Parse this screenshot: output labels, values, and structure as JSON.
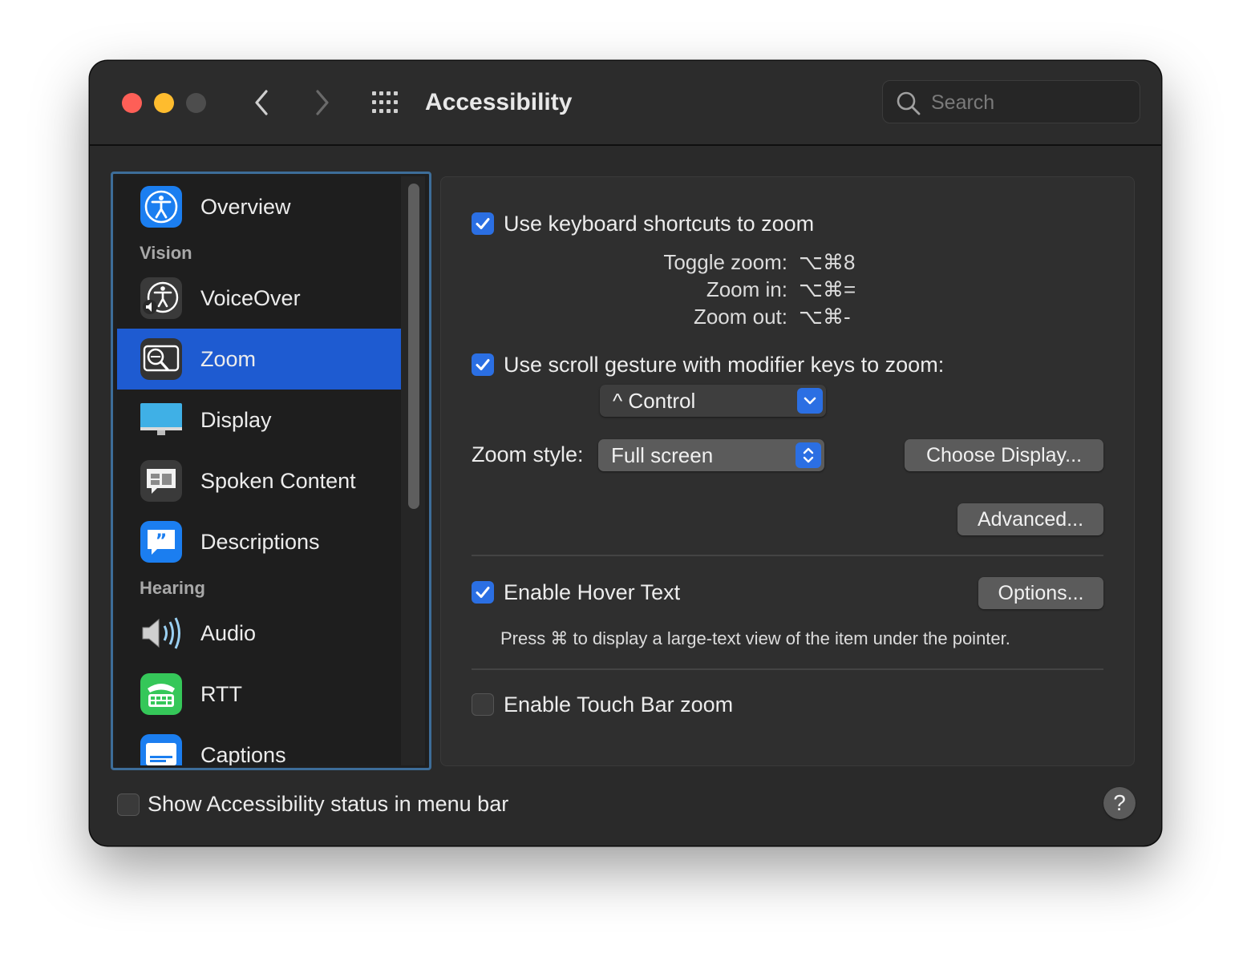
{
  "window": {
    "title": "Accessibility",
    "search_placeholder": "Search"
  },
  "sidebar": {
    "items": [
      {
        "id": "overview",
        "label": "Overview",
        "icon": "accessibility-icon"
      },
      {
        "id": "voiceover",
        "label": "VoiceOver",
        "icon": "voiceover-icon"
      },
      {
        "id": "zoom",
        "label": "Zoom",
        "icon": "zoom-icon",
        "selected": true
      },
      {
        "id": "display",
        "label": "Display",
        "icon": "display-icon"
      },
      {
        "id": "spoken-content",
        "label": "Spoken Content",
        "icon": "speech-bubble-icon"
      },
      {
        "id": "descriptions",
        "label": "Descriptions",
        "icon": "quote-bubble-icon"
      },
      {
        "id": "audio",
        "label": "Audio",
        "icon": "speaker-icon"
      },
      {
        "id": "rtt",
        "label": "RTT",
        "icon": "tty-phone-icon"
      },
      {
        "id": "captions",
        "label": "Captions",
        "icon": "captions-icon"
      }
    ],
    "sections": {
      "vision": "Vision",
      "hearing": "Hearing"
    }
  },
  "zoom": {
    "keyboard_shortcuts": {
      "label": "Use keyboard shortcuts to zoom",
      "checked": true,
      "shortcuts": [
        {
          "label": "Toggle zoom:",
          "keys": "⌥⌘8"
        },
        {
          "label": "Zoom in:",
          "keys": "⌥⌘="
        },
        {
          "label": "Zoom out:",
          "keys": "⌥⌘-"
        }
      ]
    },
    "scroll_gesture": {
      "label": "Use scroll gesture with modifier keys to zoom:",
      "checked": true,
      "modifier_value": "^ Control"
    },
    "zoom_style": {
      "label": "Zoom style:",
      "value": "Full screen"
    },
    "choose_display_label": "Choose Display...",
    "advanced_label": "Advanced...",
    "hover_text": {
      "label": "Enable Hover Text",
      "checked": true,
      "options_label": "Options...",
      "hint": "Press ⌘ to display a large-text view of the item under the pointer."
    },
    "touch_bar": {
      "label": "Enable Touch Bar zoom",
      "checked": false
    }
  },
  "footer": {
    "status_label": "Show Accessibility status in menu bar",
    "status_checked": false,
    "help_label": "?"
  },
  "colors": {
    "accent": "#2b6fe3",
    "selection": "#1e5bd1",
    "sidebar_focus_ring": "#3d6d99"
  }
}
